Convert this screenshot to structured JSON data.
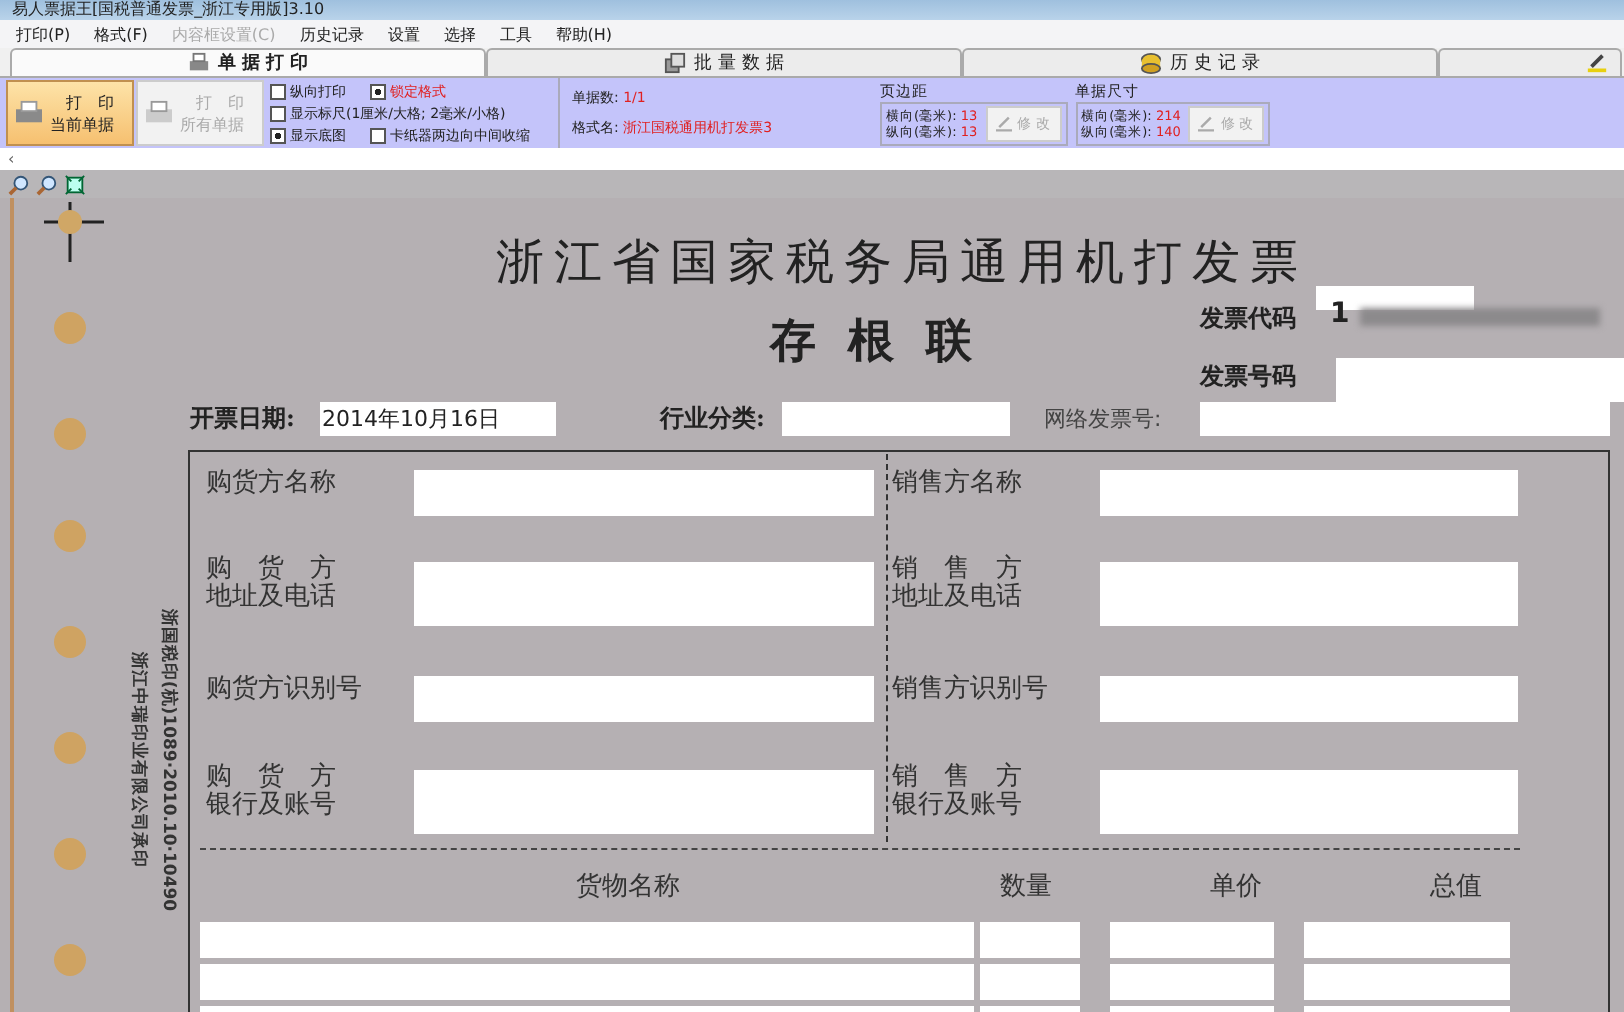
{
  "window": {
    "title": "易人票据王[国税普通发票_浙江专用版]3.10"
  },
  "menu": [
    {
      "label": "打印(P)",
      "disabled": false
    },
    {
      "label": "格式(F)",
      "disabled": false
    },
    {
      "label": "内容框设置(C)",
      "disabled": true
    },
    {
      "label": "历史记录",
      "disabled": false
    },
    {
      "label": "设置",
      "disabled": false
    },
    {
      "label": "选择",
      "disabled": false
    },
    {
      "label": "工具",
      "disabled": false
    },
    {
      "label": "帮助(H)",
      "disabled": false
    }
  ],
  "tabs": [
    {
      "label": "单 据 打 印",
      "selected": true
    },
    {
      "label": "批 量 数 据",
      "selected": false
    },
    {
      "label": "历 史 记 录",
      "selected": false
    },
    {
      "selected": false
    }
  ],
  "scroll_arrow": "‹",
  "print_buttons": [
    {
      "line1": "打　印",
      "line2": "当前单据",
      "disabled": false
    },
    {
      "line1": "打　印",
      "line2": "所有单据",
      "disabled": true
    }
  ],
  "options": [
    {
      "label": "纵向打印",
      "checked": false
    },
    {
      "label": "锁定格式",
      "checked": true
    },
    {
      "label": "显示标尺(1厘米/大格; 2毫米/小格)",
      "checked": false
    },
    {
      "label": "显示底图",
      "checked": true
    },
    {
      "label": "卡纸器两边向中间收缩",
      "checked": false
    }
  ],
  "info": [
    {
      "label": "单据数:",
      "value": "1/1"
    },
    {
      "label": "格式名:",
      "value": "浙江国税通用机打发票3"
    }
  ],
  "size_groups": [
    {
      "title": "页边距",
      "rows": [
        {
          "label": "横向(毫米):",
          "value": "13"
        },
        {
          "label": "纵向(毫米):",
          "value": "13"
        }
      ],
      "button": "修 改"
    },
    {
      "title": "单据尺寸",
      "rows": [
        {
          "label": "横向(毫米):",
          "value": "214"
        },
        {
          "label": "纵向(毫米):",
          "value": "140"
        }
      ],
      "button": "修 改"
    }
  ],
  "invoice": {
    "title": "浙江省国家税务局通用机打发票",
    "subtitle": "存 根 联",
    "code_label": "发票代码",
    "code_value": "1",
    "number_label": "发票号码",
    "date_label": "开票日期:",
    "date_value": "2014年10月16日",
    "industry_label": "行业分类:",
    "web_no_label": "网络发票号:",
    "buyer": [
      [
        "购货方名称"
      ],
      [
        "购　货　方",
        "地址及电话"
      ],
      [
        "购货方识别号"
      ],
      [
        "购　货　方",
        "银行及账号"
      ]
    ],
    "seller": [
      [
        "销售方名称"
      ],
      [
        "销　售　方",
        "地址及电话"
      ],
      [
        "销售方识别号"
      ],
      [
        "销　售　方",
        "银行及账号"
      ]
    ],
    "columns": [
      "货物名称",
      "数量",
      "单价",
      "总值"
    ],
    "side_print": [
      "浙国税印(杭)1089·2010.10·10490",
      "浙江中瑞印业有限公司承印"
    ]
  }
}
